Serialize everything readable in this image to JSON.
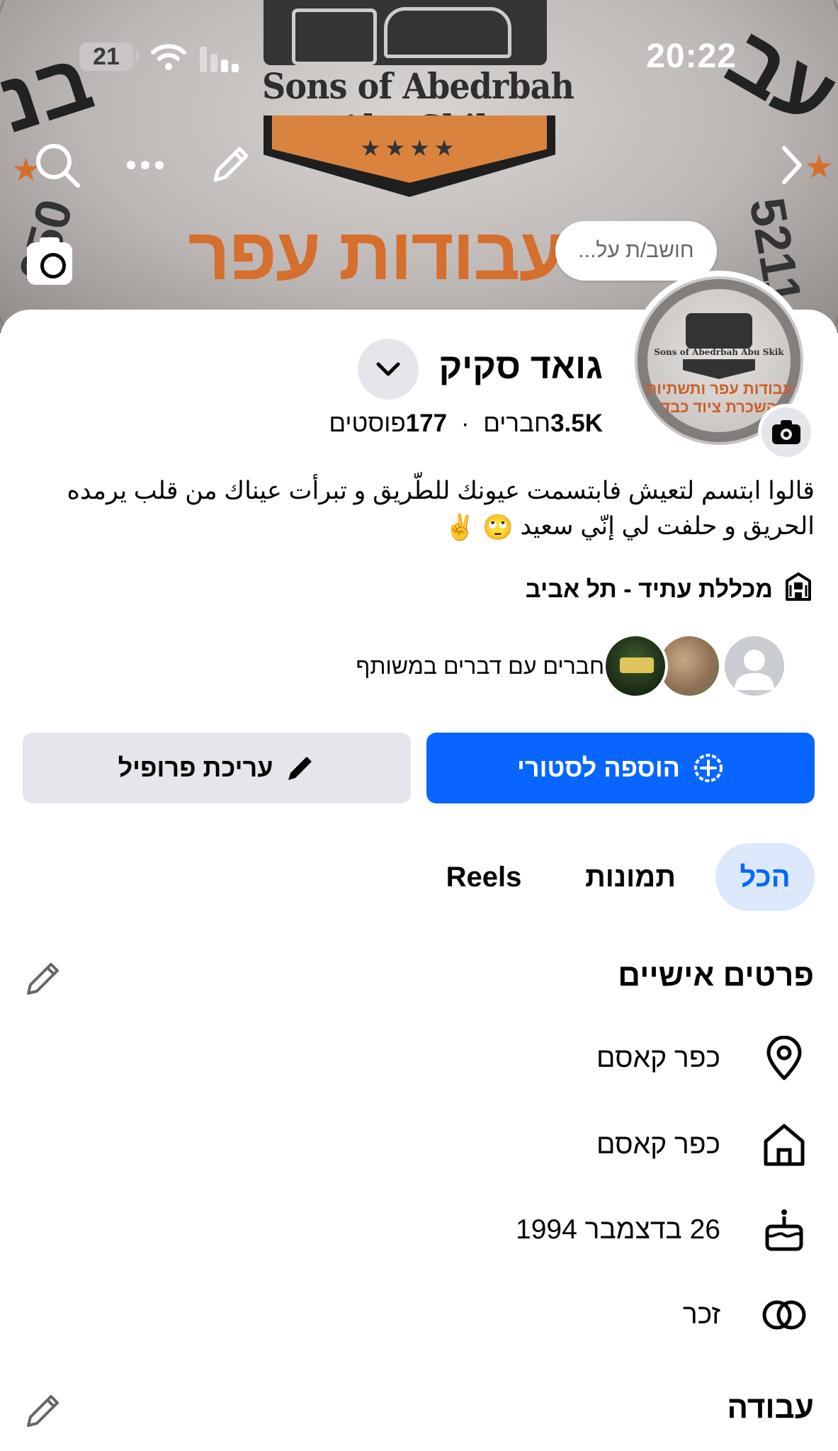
{
  "status_bar": {
    "time": "20:22",
    "battery": "21"
  },
  "cover": {
    "title_en": "Sons of Abedrbah Abu Skik",
    "stars": "★★★★",
    "headline": "עבודות עפר ותשתיות",
    "side_left": "בנ",
    "side_right": "עב",
    "number_left": "050",
    "number_right": "5211"
  },
  "thinking_bubble": "חושב/ת על...",
  "avatar": {
    "title_en": "Sons of Abedrbah Abu Skik",
    "line1": "עבודות עפר ותשתיות",
    "line2": "השכרת ציוד כבד"
  },
  "profile": {
    "name": "גואד סקיק",
    "friends_count": "3.5K",
    "friends_label": "חברים",
    "separator": "·",
    "posts_count": "177",
    "posts_label": "פוסטים",
    "bio": "قالوا ابتسم لتعيش فابتسمت عيونك للطّريق و تبرأت عيناك من قلب يرمده الحريق و حلفت لي إنّي سعيد",
    "bio_emojis": "🙄 ✌️",
    "education": "מכללת עתיד - תל אביב",
    "mutual_label": "חברים עם דברים במשותף"
  },
  "actions": {
    "add_story": "הוספה לסטורי",
    "edit_profile": "עריכת פרופיל"
  },
  "tabs": {
    "all": "הכל",
    "photos": "תמונות",
    "reels": "Reels"
  },
  "personal_details": {
    "title": "פרטים אישיים",
    "current_city": "כפר קאסם",
    "hometown": "כפר קאסם",
    "birthday": "26 בדצמבר 1994",
    "gender": "זכר"
  },
  "work": {
    "title": "עבודה"
  },
  "colors": {
    "accent": "#0866ff",
    "tab_bg": "#dce9fd",
    "secondary_btn": "#e4e6eb"
  }
}
